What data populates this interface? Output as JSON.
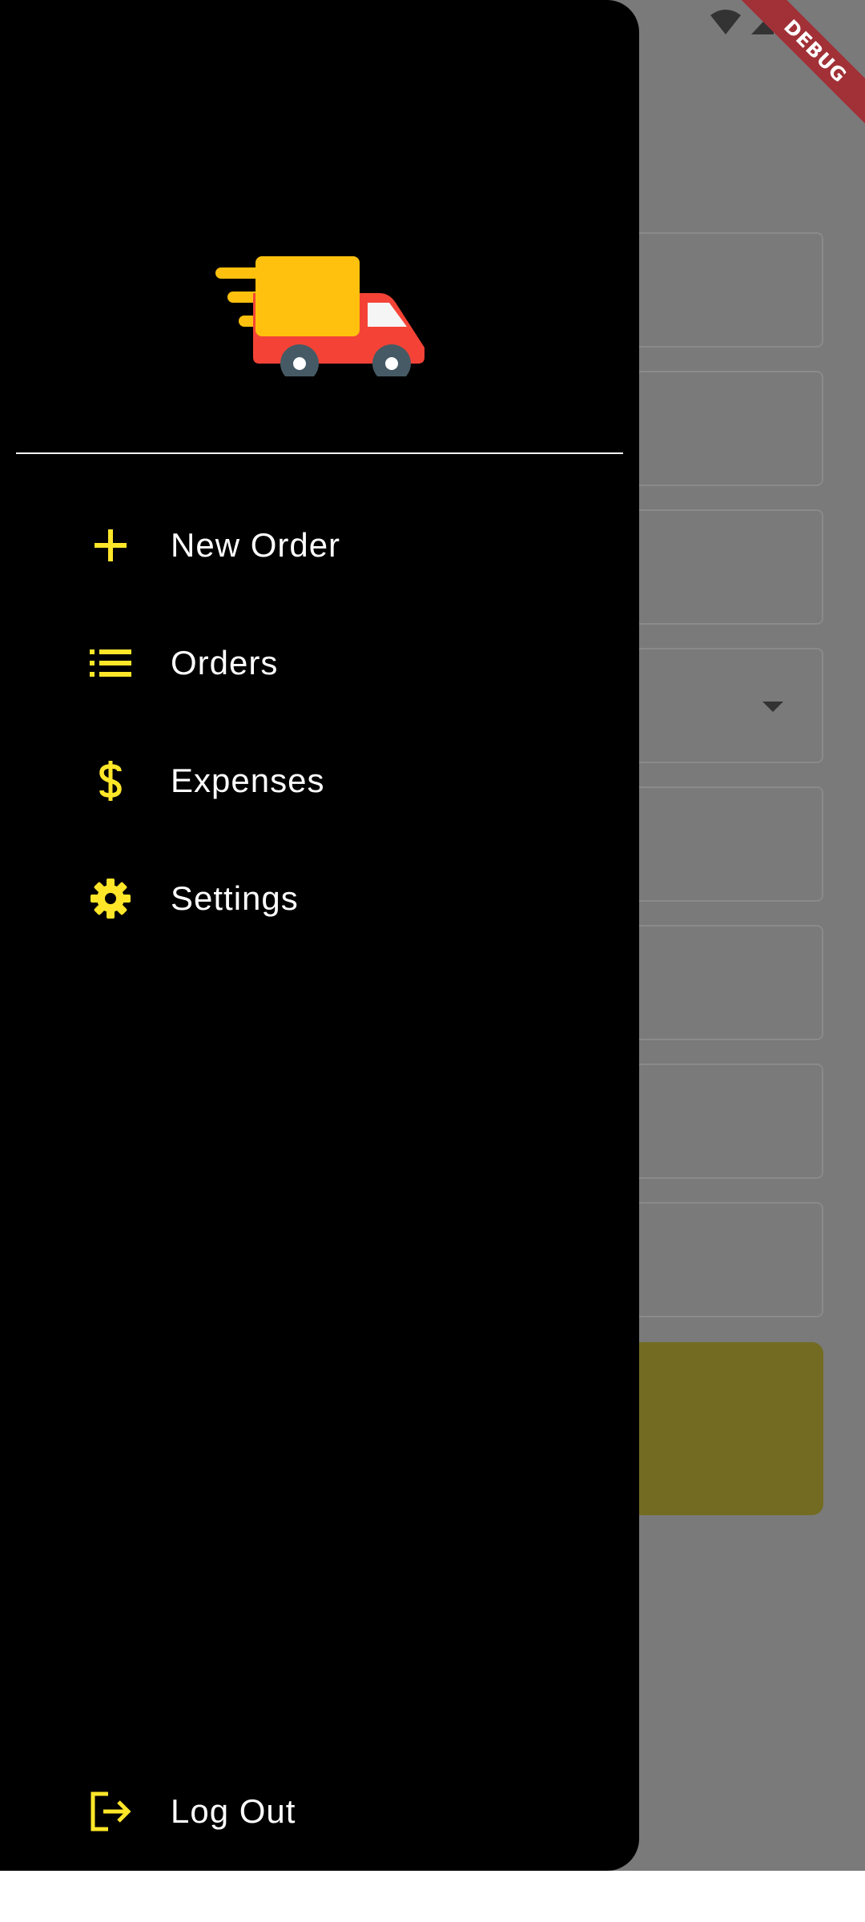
{
  "debug_banner": "DEBUG",
  "drawer": {
    "logo_icon": "delivery-truck-icon",
    "menu": [
      {
        "label": "New Order",
        "icon": "plus-icon"
      },
      {
        "label": "Orders",
        "icon": "list-icon"
      },
      {
        "label": "Expenses",
        "icon": "dollar-icon"
      },
      {
        "label": "Settings",
        "icon": "gear-icon"
      }
    ],
    "logout": {
      "label": "Log Out",
      "icon": "logout-icon"
    }
  },
  "colors": {
    "accent": "#FFE629",
    "drawer_bg": "#000000",
    "scrim": "#7A7A7A",
    "truck_cargo": "#FFC10E",
    "truck_cab": "#F44336",
    "wheel": "#455A64"
  }
}
